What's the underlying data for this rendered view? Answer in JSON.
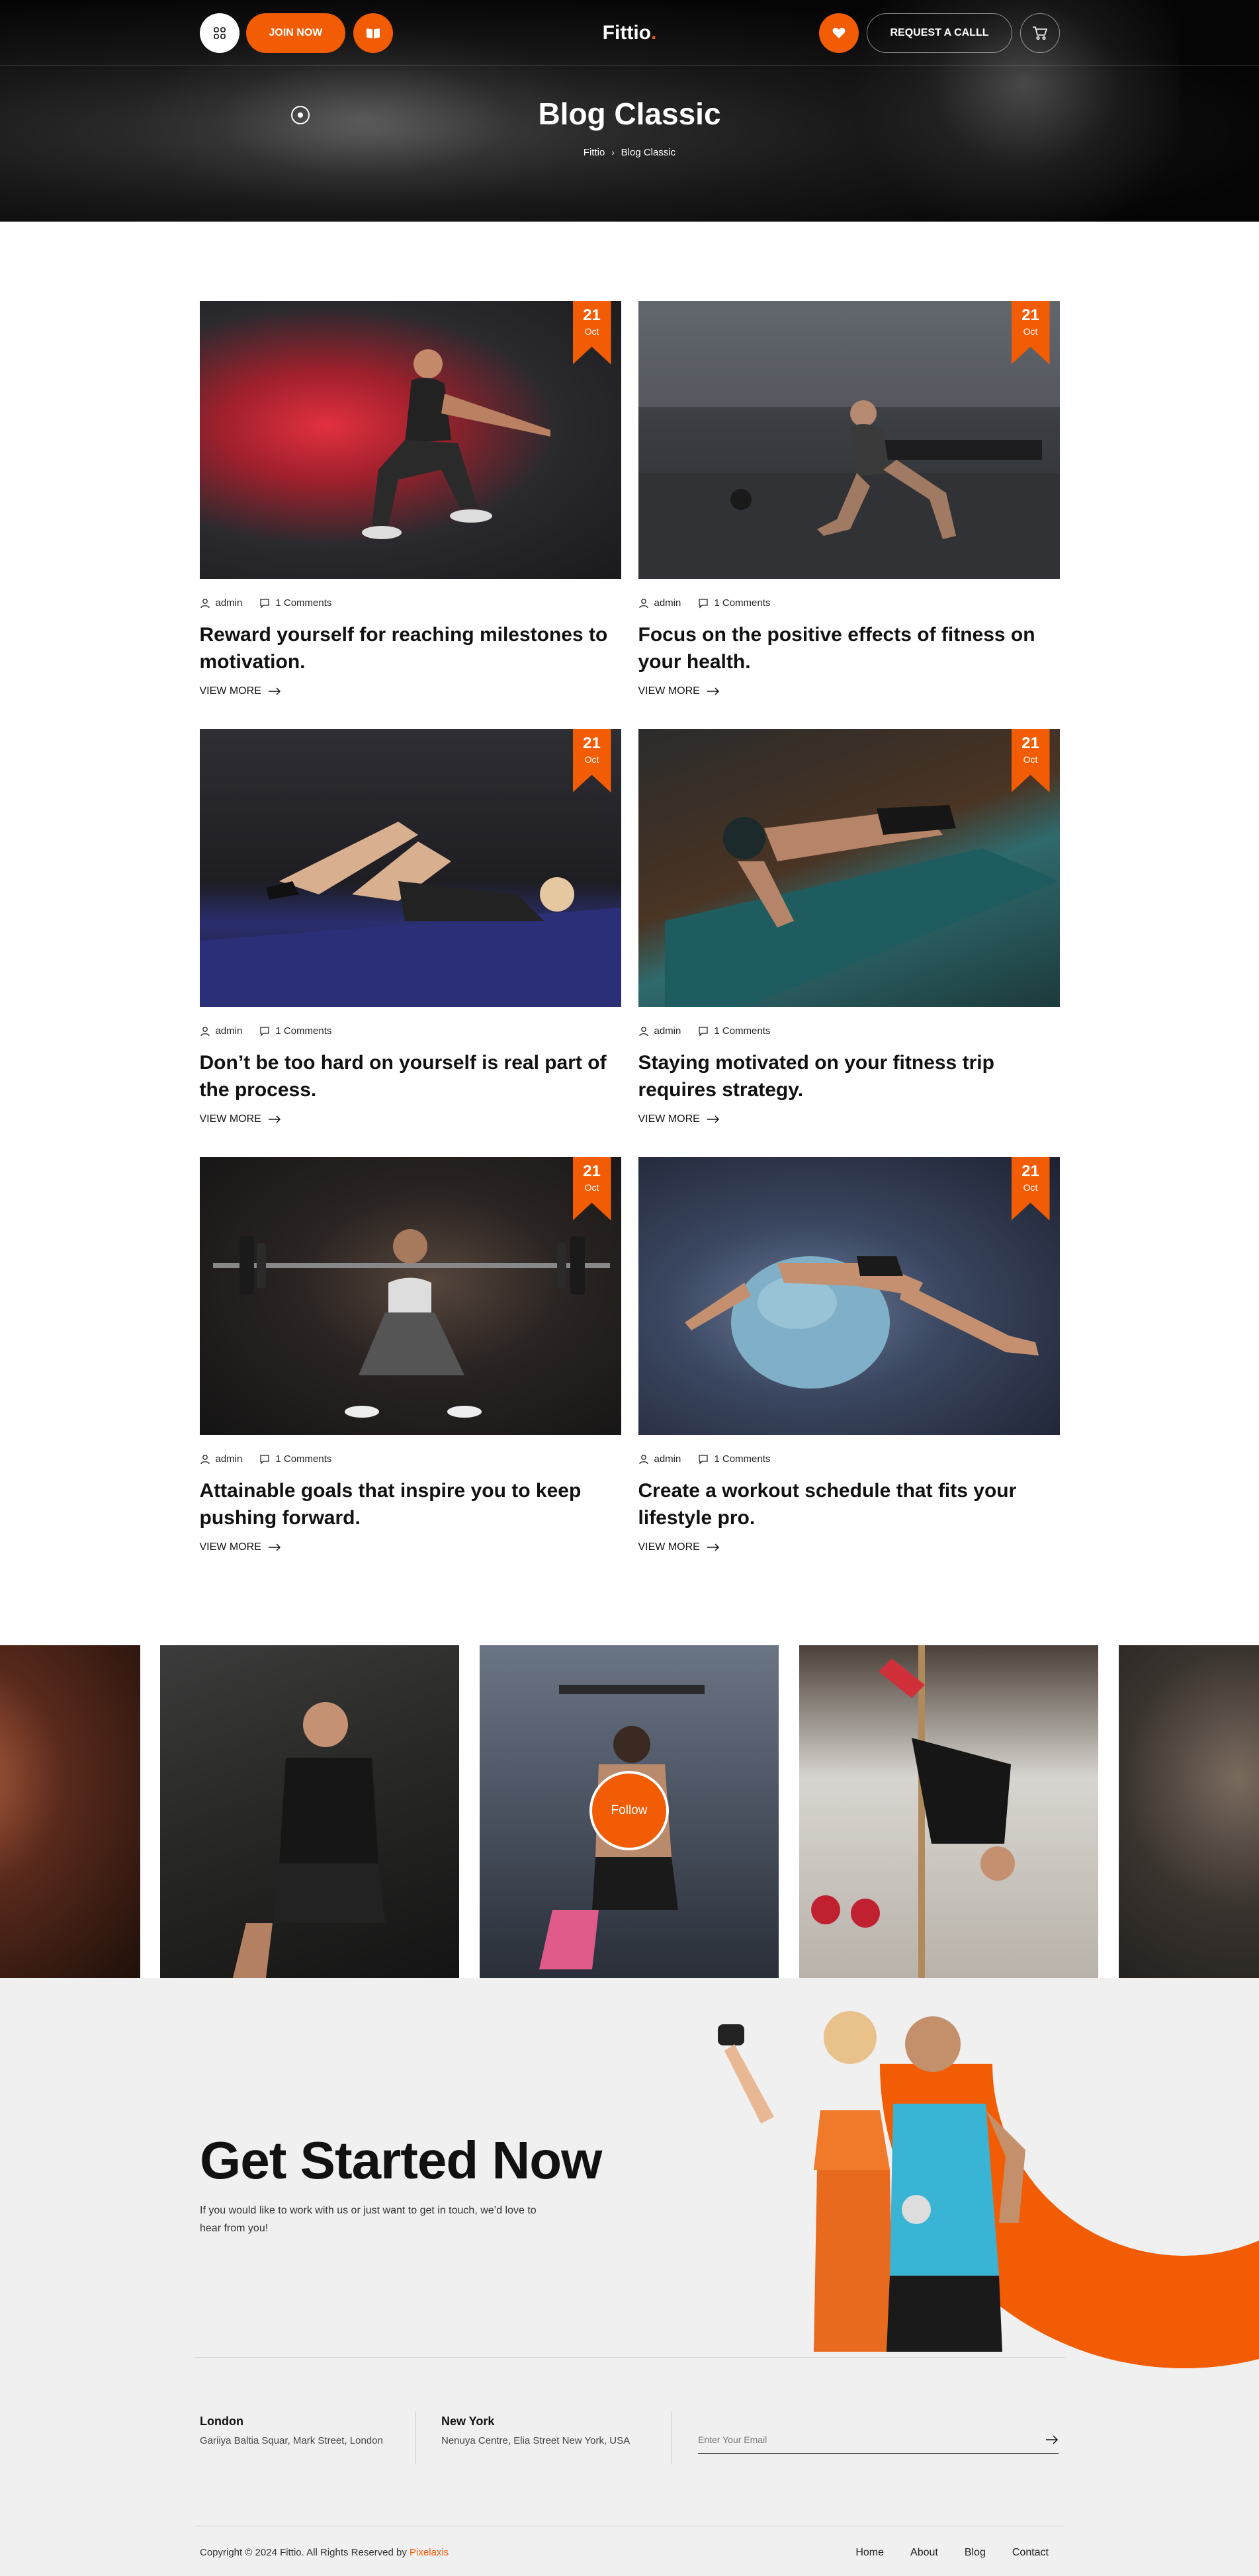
{
  "header": {
    "join_label": "JOIN NOW",
    "logo_main": "Fittio",
    "logo_dot": ".",
    "call_label": "REQUEST A CALLL"
  },
  "hero": {
    "title": "Blog Classic",
    "breadcrumb": [
      "Fittio",
      "Blog Classic"
    ],
    "breadcrumb_sep": "›"
  },
  "posts": [
    {
      "day": "21",
      "month": "Oct",
      "author": "admin",
      "comments": "1 Comments",
      "title": "Reward yourself for reaching milestones to motivation.",
      "more": "VIEW MORE"
    },
    {
      "day": "21",
      "month": "Oct",
      "author": "admin",
      "comments": "1 Comments",
      "title": "Focus on the positive effects of fitness on your health.",
      "more": "VIEW MORE"
    },
    {
      "day": "21",
      "month": "Oct",
      "author": "admin",
      "comments": "1 Comments",
      "title": "Don’t be too hard on yourself is real part of the process.",
      "more": "VIEW MORE"
    },
    {
      "day": "21",
      "month": "Oct",
      "author": "admin",
      "comments": "1 Comments",
      "title": "Staying motivated on your fitness trip requires strategy.",
      "more": "VIEW MORE"
    },
    {
      "day": "21",
      "month": "Oct",
      "author": "admin",
      "comments": "1 Comments",
      "title": "Attainable goals that inspire you to keep pushing forward.",
      "more": "VIEW MORE"
    },
    {
      "day": "21",
      "month": "Oct",
      "author": "admin",
      "comments": "1 Comments",
      "title": "Create a workout schedule that fits your lifestyle pro.",
      "more": "VIEW MORE"
    }
  ],
  "instagram": {
    "follow_label": "Follow"
  },
  "cta": {
    "title": "Get Started Now",
    "text": "If you would like to work with us or just want to get in touch, we’d love to hear from you!"
  },
  "offices": [
    {
      "city": "London",
      "address": "Gariiya Baltia Squar, Mark Street, London"
    },
    {
      "city": "New York",
      "address": "Nenuya Centre, Elia Street New York, USA"
    }
  ],
  "newsletter": {
    "placeholder": "Enter Your Email"
  },
  "footer": {
    "copyright_prefix": "Copyright © 2024 Fittio. All Rights Reserved by ",
    "copyright_brand": "Pixelaxis",
    "nav": [
      "Home",
      "About",
      "Blog",
      "Contact"
    ]
  },
  "colors": {
    "accent": "#f25c05",
    "dark": "#0a0a0a",
    "light_bg": "#f0f0f0"
  },
  "icons": [
    "grid-icon",
    "book-icon",
    "heart-icon",
    "cart-icon",
    "user-icon",
    "comment-icon",
    "arrow-right-icon",
    "play-icon",
    "send-arrow-icon"
  ]
}
